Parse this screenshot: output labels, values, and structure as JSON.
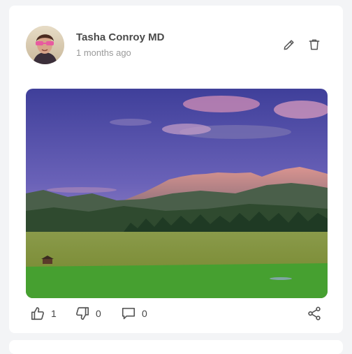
{
  "post": {
    "author": "Tasha Conroy MD",
    "time_ago": "1 months ago",
    "likes": "1",
    "dislikes": "0",
    "comments": "0"
  },
  "icons": {
    "edit": "pencil-icon",
    "delete": "trash-icon",
    "like": "thumbs-up-icon",
    "dislike": "thumbs-down-icon",
    "comment": "comment-icon",
    "share": "share-icon"
  },
  "colors": {
    "card": "#ffffff",
    "background": "#f3f4f6",
    "icon": "#555555"
  }
}
